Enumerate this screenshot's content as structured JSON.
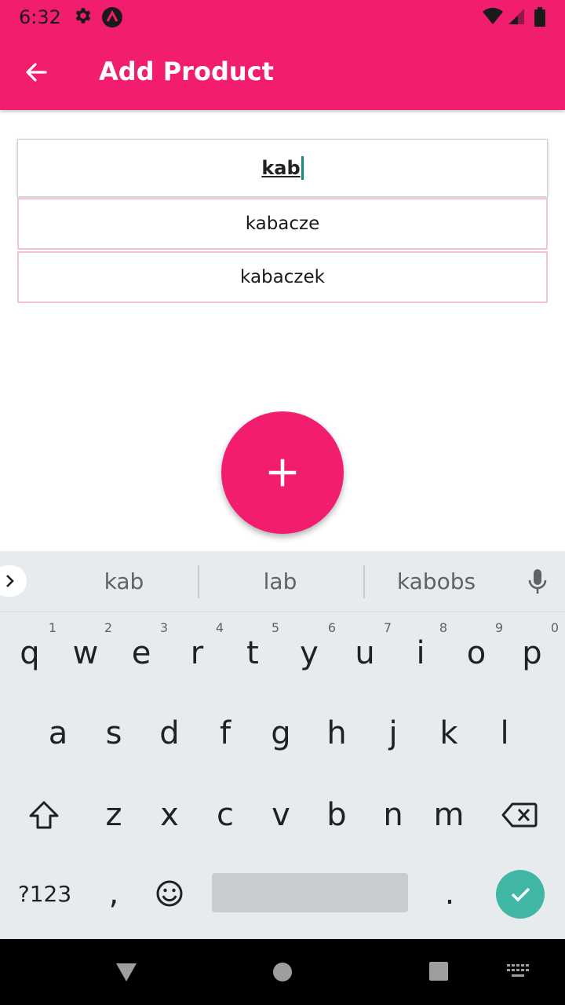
{
  "status": {
    "time": "6:32",
    "icons": [
      "settings-icon",
      "app-a-icon",
      "wifi-icon",
      "signal-icon",
      "battery-icon"
    ]
  },
  "appbar": {
    "title": "Add Product",
    "back_icon": "arrow-left-icon"
  },
  "search": {
    "value": "kab"
  },
  "suggestions": [
    "kabacze",
    "kabaczek"
  ],
  "fab": {
    "icon": "plus-icon"
  },
  "keyboard": {
    "word_suggestions": [
      "kab",
      "lab",
      "kabobs"
    ],
    "row1": [
      {
        "k": "q",
        "n": "1"
      },
      {
        "k": "w",
        "n": "2"
      },
      {
        "k": "e",
        "n": "3"
      },
      {
        "k": "r",
        "n": "4"
      },
      {
        "k": "t",
        "n": "5"
      },
      {
        "k": "y",
        "n": "6"
      },
      {
        "k": "u",
        "n": "7"
      },
      {
        "k": "i",
        "n": "8"
      },
      {
        "k": "o",
        "n": "9"
      },
      {
        "k": "p",
        "n": "0"
      }
    ],
    "row2": [
      "a",
      "s",
      "d",
      "f",
      "g",
      "h",
      "j",
      "k",
      "l"
    ],
    "row3": [
      "z",
      "x",
      "c",
      "v",
      "b",
      "n",
      "m"
    ],
    "sym_label": "?123",
    "comma": ",",
    "period": "."
  },
  "colors": {
    "accent": "#f21d6e",
    "keyboard_bg": "#e8ebee",
    "enter": "#3fb7a4",
    "suggestion_border": "#f9c3d6"
  }
}
